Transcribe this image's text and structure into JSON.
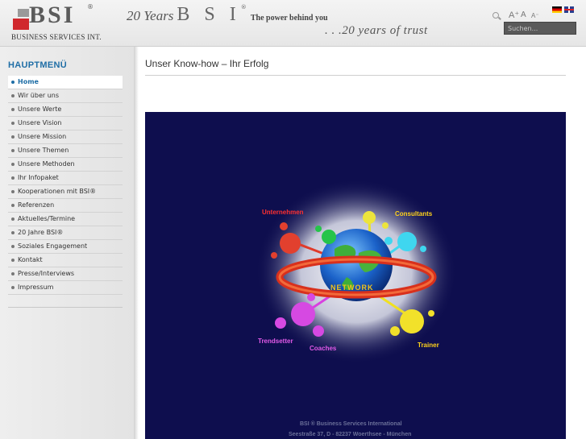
{
  "header": {
    "logo_text": "BSI",
    "logo_reg": "®",
    "logo_subtitle": "BUSINESS SERVICES INT.",
    "slogan_years": "20 Years",
    "slogan_brand": "B S I",
    "slogan_reg": "®",
    "slogan_tagline": "The power behind you",
    "slogan_trust": ". . .20 years of trust",
    "font_size_up": "A⁺",
    "font_size_reset": "A",
    "font_size_down": "A⁻",
    "search_placeholder": "Suchen..."
  },
  "sidebar": {
    "title": "HAUPTMENÜ",
    "items": [
      {
        "label": "Home",
        "active": true
      },
      {
        "label": "Wir über uns"
      },
      {
        "label": "Unsere Werte"
      },
      {
        "label": "Unsere Vision"
      },
      {
        "label": "Unsere Mission"
      },
      {
        "label": "Unsere Themen"
      },
      {
        "label": "Unsere Methoden"
      },
      {
        "label": "Ihr Infopaket"
      },
      {
        "label": "Kooperationen mit BSI®"
      },
      {
        "label": "Referenzen"
      },
      {
        "label": "Aktuelles/Termine"
      },
      {
        "label": "20 Jahre BSI®"
      },
      {
        "label": "Soziales Engagement"
      },
      {
        "label": "Kontakt"
      },
      {
        "label": "Presse/Interviews"
      },
      {
        "label": "Impressum"
      }
    ]
  },
  "main": {
    "title": "Unser Know-how – Ihr Erfolg",
    "figure": {
      "labels": {
        "unternehmen": "Unternehmen",
        "consultants": "Consultants",
        "trendsetter": "Trendsetter",
        "coaches": "Coaches",
        "trainer": "Trainer",
        "network": "NETWORK"
      },
      "footer_line1": "BSI ® Business Services International",
      "footer_line2": "Seestraße 37, D - 82237 Woerthsee - München"
    }
  },
  "colors": {
    "accent_blue": "#1f6ea6",
    "figure_bg": "#0e0e4e",
    "logo_red": "#d0282d"
  }
}
